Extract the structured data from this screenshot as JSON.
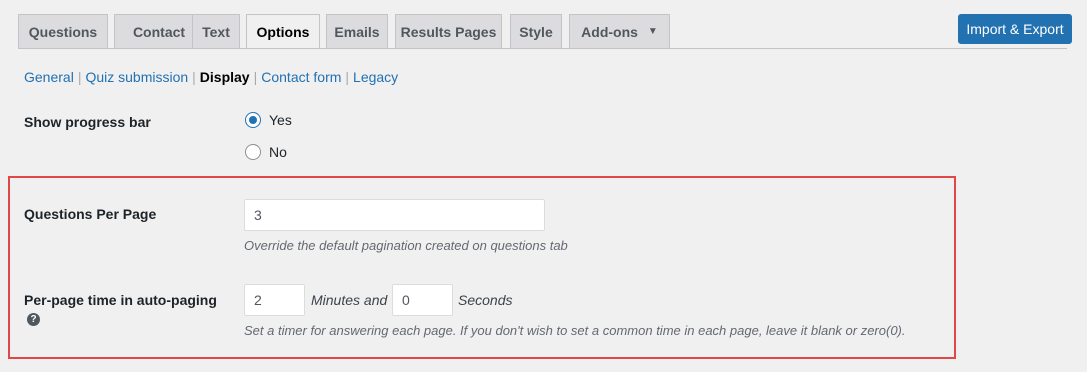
{
  "tabs": [
    {
      "label": "Questions"
    },
    {
      "label": "Contact"
    },
    {
      "label": "Text"
    },
    {
      "label": "Options",
      "active": true
    },
    {
      "label": "Emails"
    },
    {
      "label": "Results Pages"
    },
    {
      "label": "Style"
    },
    {
      "label": "Add-ons",
      "icon": "dropdown-arrow-icon",
      "arrow": "▼"
    }
  ],
  "import_export_label": "Import & Export",
  "subnav": {
    "items": [
      "General",
      "Quiz submission",
      "Display",
      "Contact form",
      "Legacy"
    ],
    "current": "Display"
  },
  "progress_bar": {
    "label": "Show progress bar",
    "options": [
      {
        "label": "Yes",
        "checked": true
      },
      {
        "label": "No",
        "checked": false
      }
    ]
  },
  "questions_per_page": {
    "label": "Questions Per Page",
    "value": "3",
    "description": "Override the default pagination created on questions tab"
  },
  "per_page_time": {
    "label": "Per-page time in auto-paging",
    "help_icon": "?",
    "minutes_value": "2",
    "minutes_label": "Minutes and",
    "seconds_value": "0",
    "seconds_label": "Seconds",
    "description": "Set a timer for answering each page. If you don't wish to set a common time in each page, leave it blank or zero(0)."
  },
  "colors": {
    "accent": "#2271b1",
    "highlight_border": "#e04848",
    "background": "#f0f0f1"
  }
}
